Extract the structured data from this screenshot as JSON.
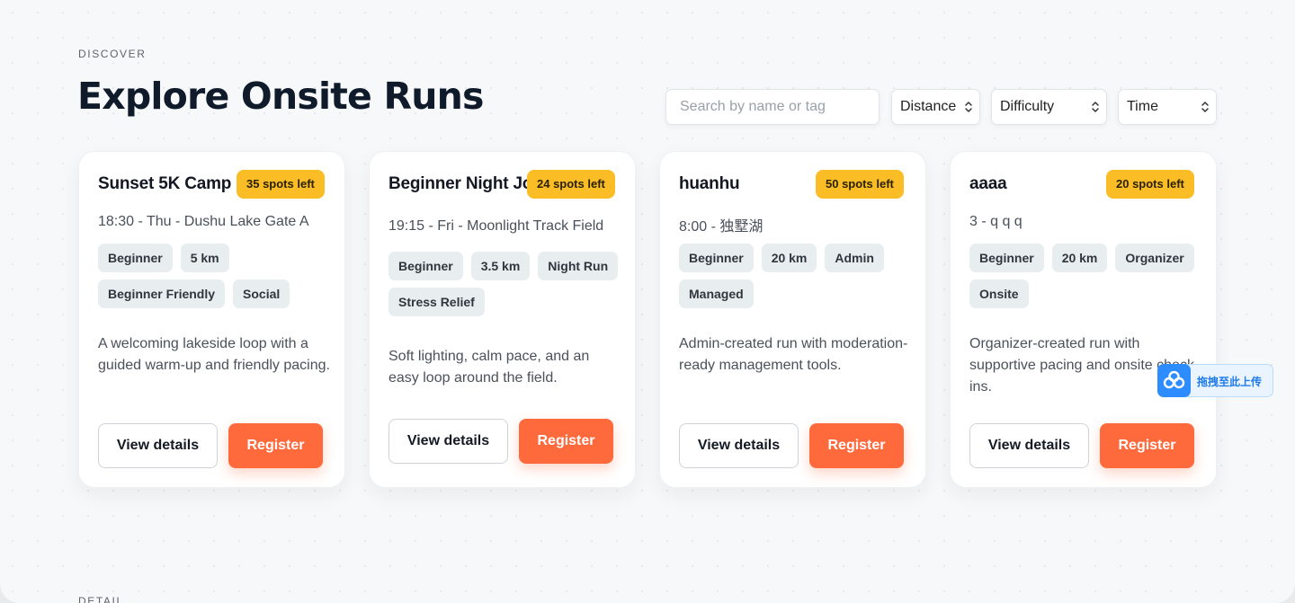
{
  "header": {
    "eyebrow": "DISCOVER",
    "title": "Explore Onsite Runs"
  },
  "filters": {
    "search_placeholder": "Search by name or tag",
    "distance_label": "Distance",
    "difficulty_label": "Difficulty",
    "time_label": "Time"
  },
  "cards": [
    {
      "name": "Sunset 5K Camp",
      "spots": "35 spots left",
      "meta": "18:30 - Thu - Dushu Lake Gate A",
      "tags": [
        "Beginner",
        "5 km",
        "Beginner Friendly",
        "Social"
      ],
      "description": "A welcoming lakeside loop with a guided warm-up and friendly pacing.",
      "view_label": "View details",
      "register_label": "Register"
    },
    {
      "name": "Beginner Night Jog",
      "spots": "24 spots left",
      "meta": "19:15 - Fri - Moonlight Track Field",
      "tags": [
        "Beginner",
        "3.5 km",
        "Night Run",
        "Stress Relief"
      ],
      "description": "Soft lighting, calm pace, and an easy loop around the field.",
      "view_label": "View details",
      "register_label": "Register"
    },
    {
      "name": "huanhu",
      "spots": "50 spots left",
      "meta": "8:00 - 独墅湖",
      "tags": [
        "Beginner",
        "20 km",
        "Admin",
        "Managed"
      ],
      "description": "Admin-created run with moderation-ready management tools.",
      "view_label": "View details",
      "register_label": "Register"
    },
    {
      "name": "aaaa",
      "spots": "20 spots left",
      "meta": "3 - q q q",
      "tags": [
        "Beginner",
        "20 km",
        "Organizer",
        "Onsite"
      ],
      "description": "Organizer-created run with supportive pacing and onsite check-ins.",
      "view_label": "View details",
      "register_label": "Register"
    }
  ],
  "overlay": {
    "upload_label": "拖拽至此上传"
  },
  "next_section": {
    "eyebrow": "DETAIL"
  },
  "colors": {
    "accent": "#ff6a3d",
    "badge": "#fbbd26",
    "tag_bg": "#e8edf0",
    "title": "#0f1a2b"
  }
}
